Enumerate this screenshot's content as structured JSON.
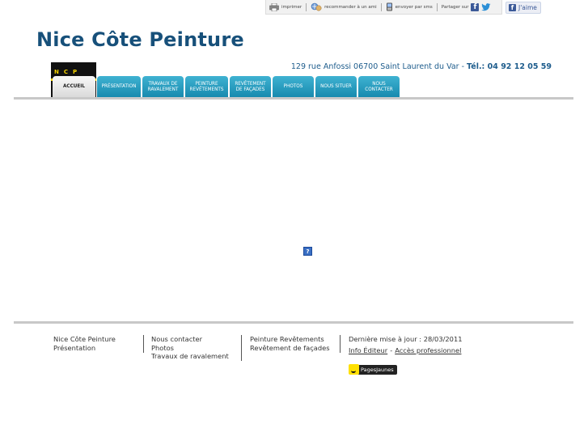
{
  "topbar": {
    "print_label": "imprimer",
    "recommend_label": "recommander à un ami",
    "sms_label": "envoyer par sms",
    "share_label": "Partager sur",
    "like_label": "J'aime"
  },
  "site": {
    "title": "Nice Côte Peinture",
    "address": "129 rue Anfossi 06700 Saint Laurent du Var",
    "address_sep": " - ",
    "tel_label": "Tél.: 04 92 12 05 59",
    "logo_letters": "NCP"
  },
  "nav": {
    "tabs": [
      {
        "label": "Accueil"
      },
      {
        "label": "Présentation"
      },
      {
        "label": "Travaux de ravalement"
      },
      {
        "label": "Peinture Revêtements"
      },
      {
        "label": "Revêtement de façades"
      },
      {
        "label": "Photos"
      },
      {
        "label": "Nous situer"
      },
      {
        "label": "Nous contacter"
      }
    ]
  },
  "content": {
    "plugin_glyph": "?"
  },
  "footer": {
    "col1": [
      "Nice Côte Peinture",
      "Présentation"
    ],
    "col2": [
      "Nous contacter",
      "Photos",
      "Travaux de ravalement"
    ],
    "col3": [
      "Peinture Revêtements",
      "Revêtement de façades"
    ],
    "updated": "Dernière mise à jour : 28/03/2011",
    "info_editor": "Info Éditeur",
    "dash": "-",
    "pro_access": "Accès professionnel",
    "badge_label": "PagesJaunes"
  },
  "colors": {
    "title": "#17507a",
    "nav_tab": "#2aa2c6",
    "accent_yellow": "#f4d200"
  }
}
